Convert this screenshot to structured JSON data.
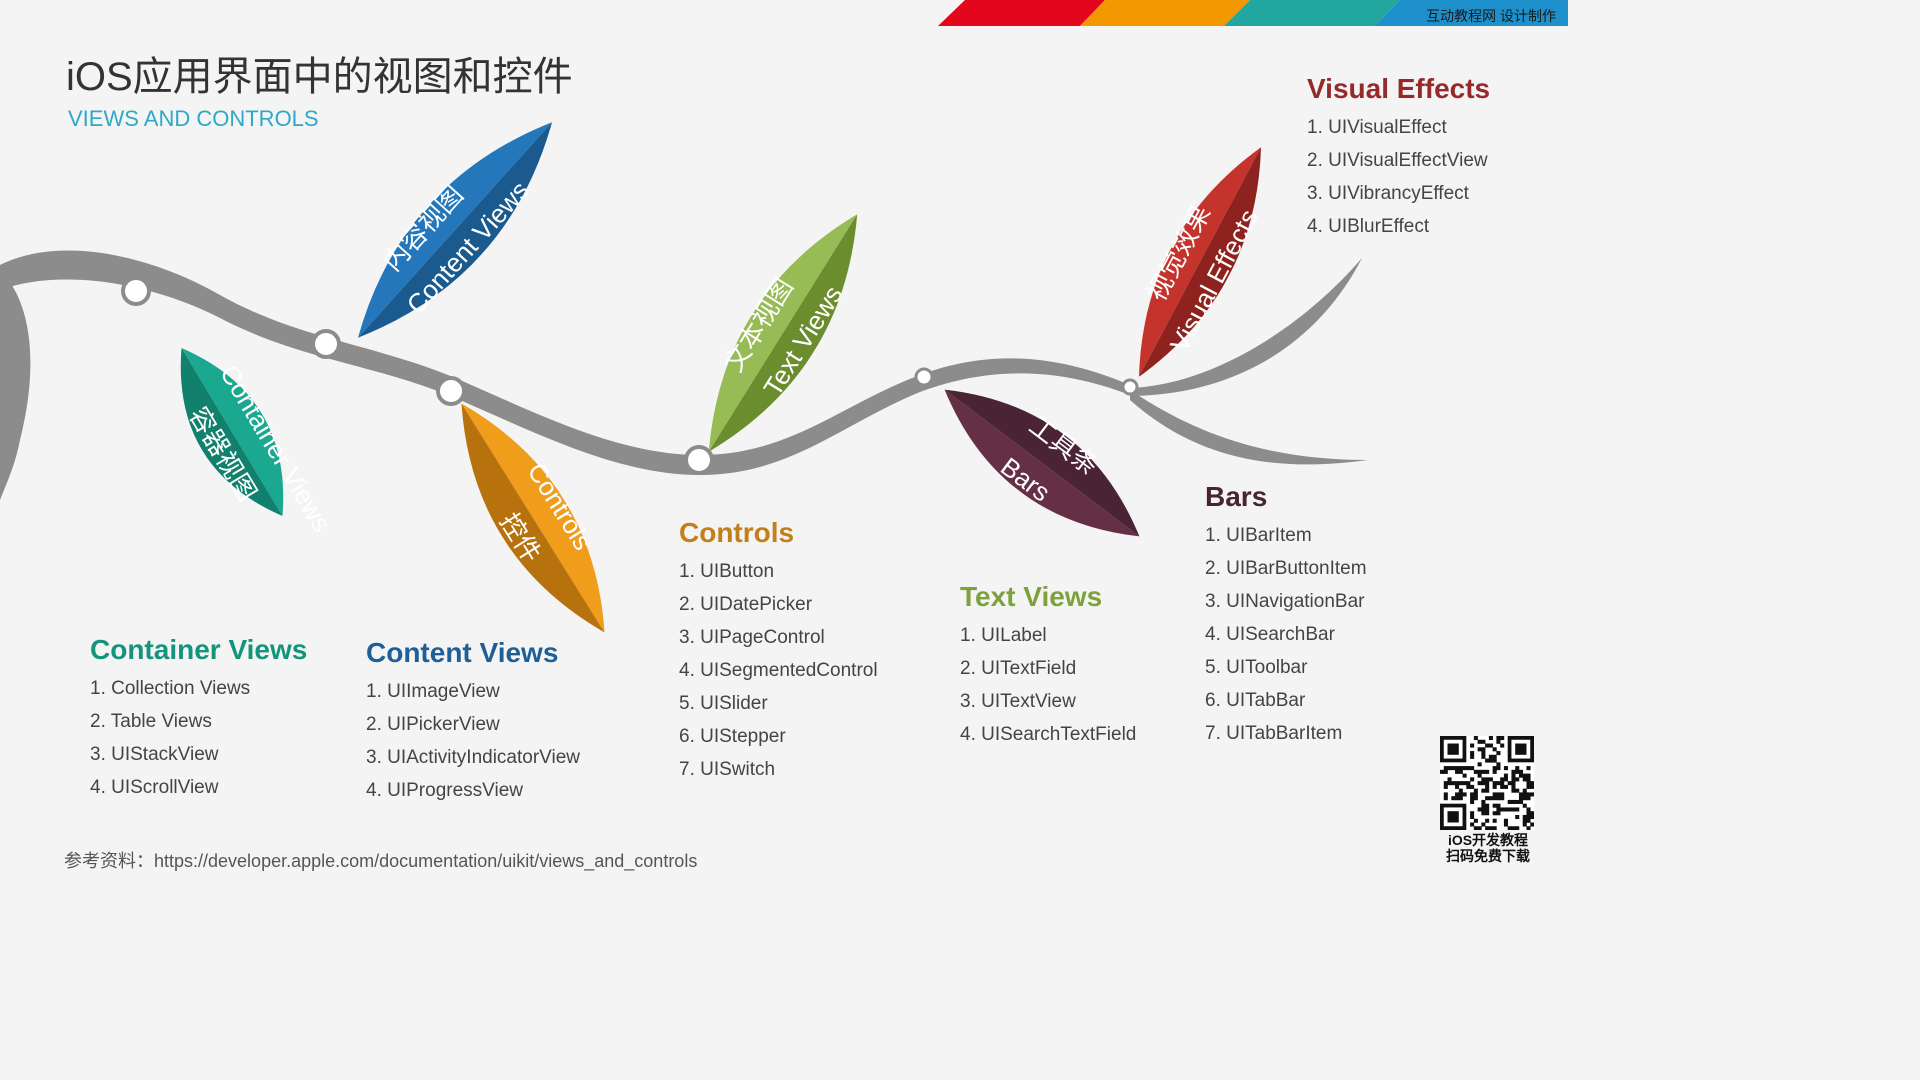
{
  "header": {
    "title_zh": "iOS应用界面中的视图和控件",
    "title_en": "VIEWS AND CONTROLS",
    "brand": "互动教程网 设计制作"
  },
  "colors": {
    "container": "#15a08b",
    "content": "#1f6fb0",
    "controls": "#e39219",
    "text": "#7da13c",
    "bars": "#52283a",
    "effects": "#b92f2a",
    "branch": "#8c8c8c",
    "stripe": [
      "#e3071e",
      "#f39800",
      "#22a6a0",
      "#1d8fcb"
    ]
  },
  "leaves": [
    {
      "id": "container",
      "zh": "容器视图",
      "en": "Container Views"
    },
    {
      "id": "content",
      "zh": "内容视图",
      "en": "Content Views"
    },
    {
      "id": "controls",
      "zh": "控件",
      "en": "Controls"
    },
    {
      "id": "text",
      "zh": "文本视图",
      "en": "Text Views"
    },
    {
      "id": "bars",
      "zh": "工具条",
      "en": "Bars"
    },
    {
      "id": "effects",
      "zh": "视觉效果",
      "en": "Visual Effects"
    }
  ],
  "sections": {
    "container": {
      "title": "Container Views",
      "items": [
        "1. Collection Views",
        "2. Table Views",
        "3. UIStackView",
        "4. UIScrollView"
      ]
    },
    "content": {
      "title": "Content Views",
      "items": [
        "1. UIImageView",
        "2. UIPickerView",
        "3. UIActivityIndicatorView",
        "4. UIProgressView"
      ]
    },
    "controls": {
      "title": "Controls",
      "items": [
        "1. UIButton",
        "2. UIDatePicker",
        "3. UIPageControl",
        "4. UISegmentedControl",
        "5. UISlider",
        "6. UIStepper",
        "7. UISwitch"
      ]
    },
    "text": {
      "title": "Text Views",
      "items": [
        "1. UILabel",
        "2. UITextField",
        "3. UITextView",
        "4. UISearchTextField"
      ]
    },
    "bars": {
      "title": "Bars",
      "items": [
        "1. UIBarItem",
        "2. UIBarButtonItem",
        "3. UINavigationBar",
        "4. UISearchBar",
        "5. UIToolbar",
        "6. UITabBar",
        "7. UITabBarItem"
      ]
    },
    "effects": {
      "title": "Visual Effects",
      "items": [
        "1. UIVisualEffect",
        "2. UIVisualEffectView",
        "3. UIVibrancyEffect",
        "4. UIBlurEffect"
      ]
    }
  },
  "footer": {
    "reference": "参考资料：https://developer.apple.com/documentation/uikit/views_and_controls",
    "qr_caption_1": "iOS开发教程",
    "qr_caption_2": "扫码免费下载"
  }
}
